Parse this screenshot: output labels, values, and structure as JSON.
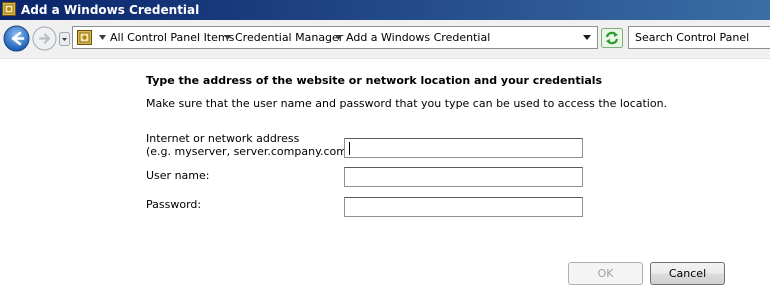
{
  "window": {
    "title": "Add a Windows Credential"
  },
  "address_bar": {
    "breadcrumbs": [
      "All Control Panel Items",
      "Credential Manager",
      "Add a Windows Credential"
    ],
    "icons": {
      "back": "back-arrow-icon",
      "forward": "forward-arrow-icon",
      "history": "chevron-down-icon",
      "location": "control-panel-icon",
      "separator": "triangle-right-icon",
      "refresh": "refresh-icon"
    }
  },
  "search": {
    "placeholder": "Search Control Panel"
  },
  "form": {
    "heading": "Type the address of the website or network location and your credentials",
    "description": "Make sure that the user name and password that you type can be used to access the location.",
    "address_label_line1": "Internet or network address",
    "address_label_line2": "(e.g. myserver, server.company.com):",
    "username_label": "User name:",
    "password_label": "Password:",
    "address_value": "",
    "username_value": "",
    "password_value": ""
  },
  "buttons": {
    "ok": "OK",
    "cancel": "Cancel"
  },
  "colors": {
    "titlebar_start": "#0a246a",
    "titlebar_end": "#3a6ea5",
    "back_button": "#2b6dc1",
    "refresh": "#3aa83a"
  }
}
